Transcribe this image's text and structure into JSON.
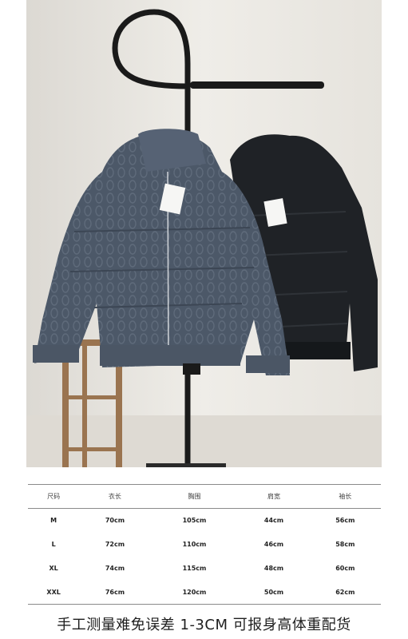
{
  "table": {
    "headers": [
      "尺码",
      "衣长",
      "胸围",
      "肩宽",
      "袖长"
    ],
    "rows": [
      [
        "M",
        "70cm",
        "105cm",
        "44cm",
        "56cm"
      ],
      [
        "L",
        "72cm",
        "110cm",
        "46cm",
        "58cm"
      ],
      [
        "XL",
        "74cm",
        "115cm",
        "48cm",
        "60cm"
      ],
      [
        "XXL",
        "76cm",
        "120cm",
        "50cm",
        "62cm"
      ]
    ]
  },
  "caption": "手工测量难免误差 1-3CM  可报身高体重配货",
  "colors": {
    "jacket_left": "#4a5565",
    "jacket_right": "#1f2226",
    "wall": "#e9e6e0",
    "stool": "#9a7450"
  }
}
